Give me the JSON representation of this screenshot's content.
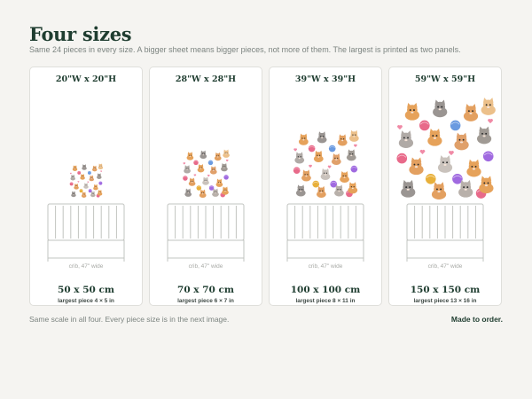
{
  "header": {
    "title": "Four sizes",
    "subtitle": "Same 24 pieces in every size. A bigger sheet means bigger pieces, not more of them. The largest is printed as two panels."
  },
  "cards": [
    {
      "size_in": "20\"W x 20\"H",
      "crib_label": "crib, 47\" wide",
      "size_cm": "50 x 50 cm",
      "piece": "largest piece 4 × 5 in",
      "artwork": "kitten-decal-sheet"
    },
    {
      "size_in": "28\"W x 28\"H",
      "crib_label": "crib, 47\" wide",
      "size_cm": "70 x 70 cm",
      "piece": "largest piece 6 × 7 in",
      "artwork": "kitten-decal-sheet"
    },
    {
      "size_in": "39\"W x 39\"H",
      "crib_label": "crib, 47\" wide",
      "size_cm": "100 x 100 cm",
      "piece": "largest piece 8 × 11 in",
      "artwork": "kitten-decal-sheet"
    },
    {
      "size_in": "59\"W x 59\"H",
      "crib_label": "crib, 47\" wide",
      "size_cm": "150 x 150 cm",
      "piece": "largest piece 13 × 16 in",
      "artwork": "kitten-decal-sheet"
    }
  ],
  "footer": {
    "note": "Same scale in all four. Every piece size is in the next image.",
    "order": "Made to order."
  },
  "colors": {
    "heading": "#1f3d30",
    "muted": "#7c8480",
    "card_border": "#dfdfdb",
    "background": "#f5f4f1"
  }
}
